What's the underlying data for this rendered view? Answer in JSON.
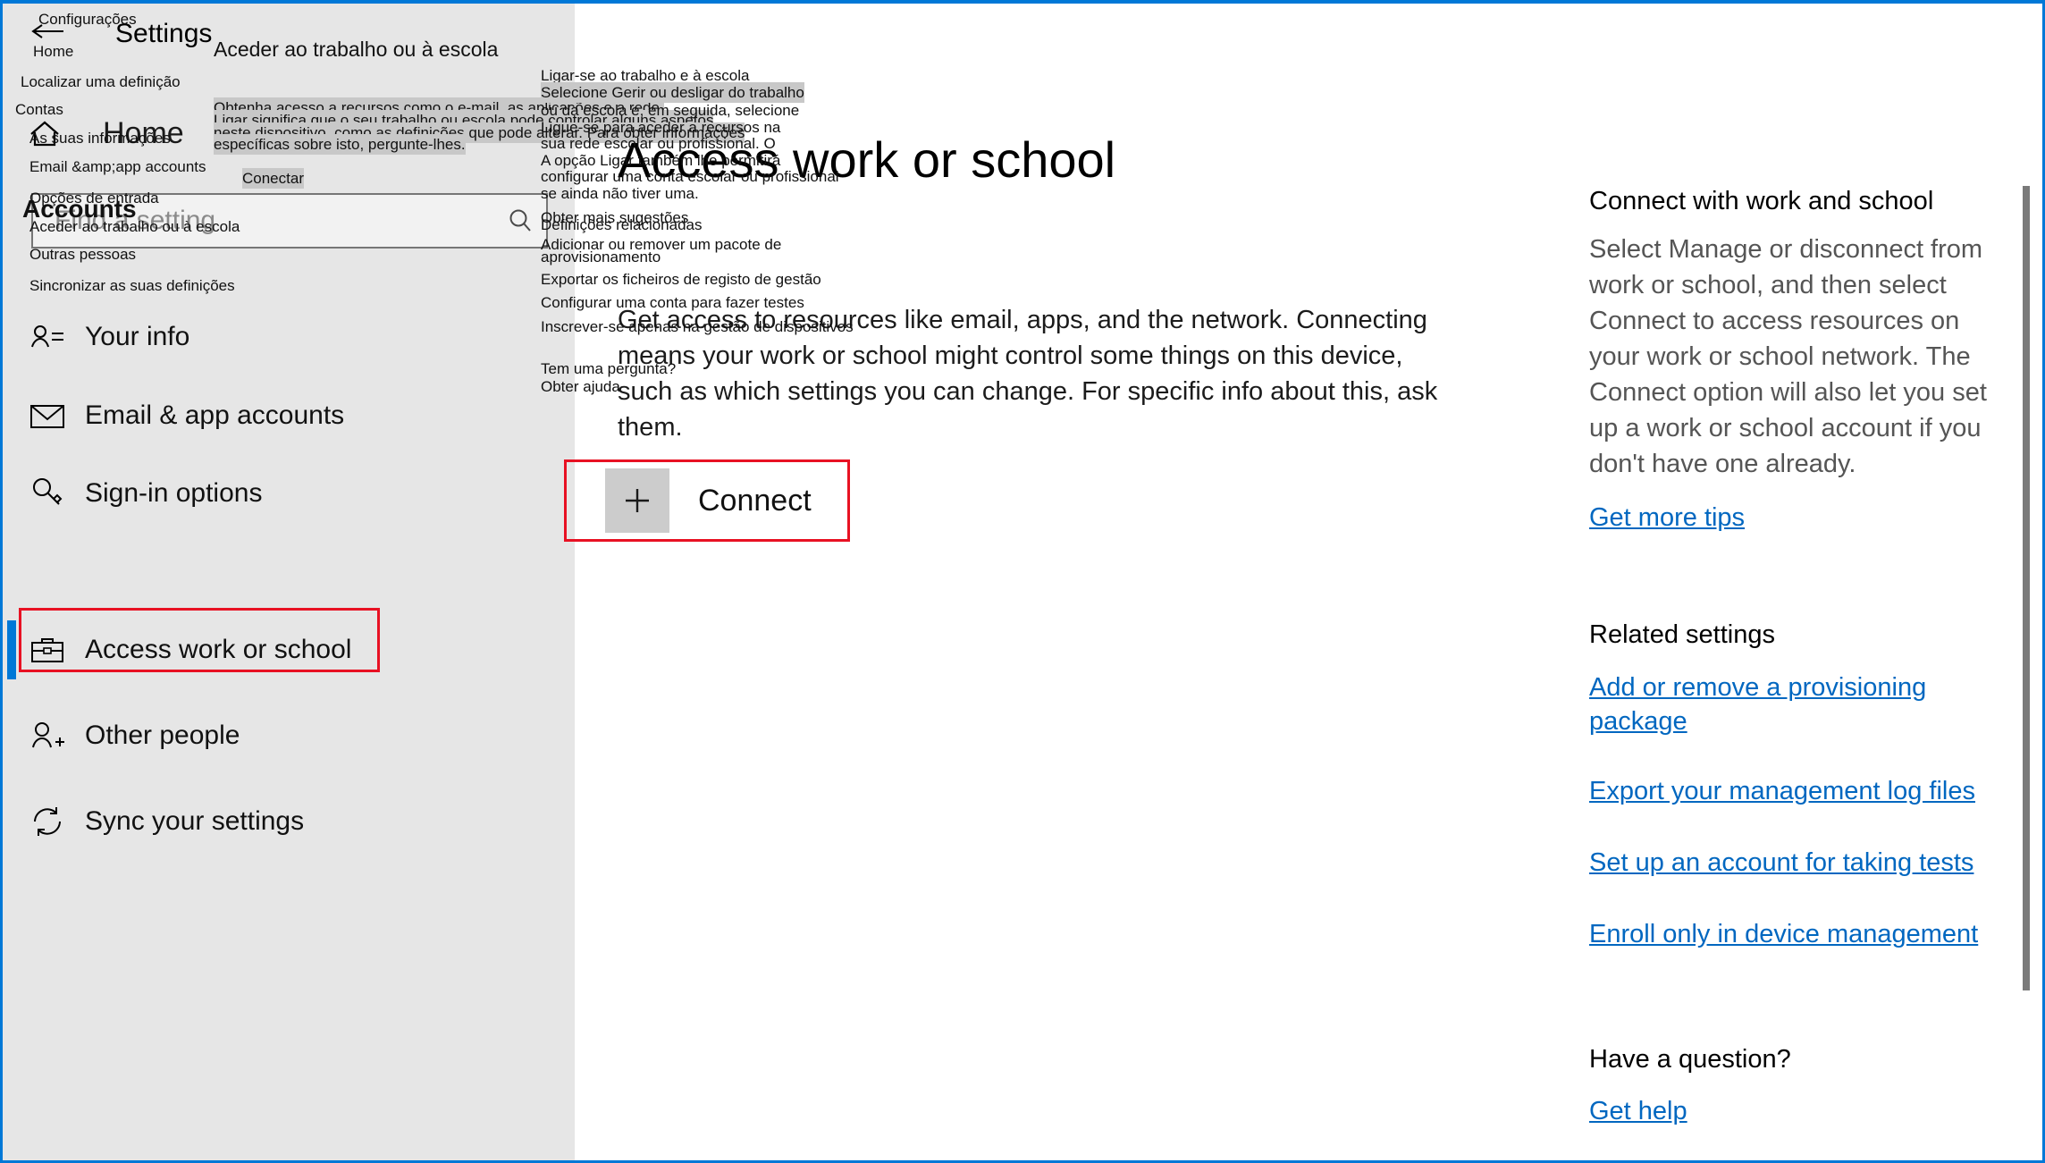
{
  "window": {
    "accent_color": "#0078d7",
    "controls": [
      {
        "name": "minimize",
        "glyph": "minimize-icon"
      },
      {
        "name": "maximize",
        "glyph": "maximize-icon"
      },
      {
        "name": "close",
        "glyph": "close-icon"
      }
    ]
  },
  "sidebar": {
    "app_title": "Settings",
    "back_label": "back-arrow-icon",
    "home": {
      "label": "Home",
      "icon": "home-icon"
    },
    "search": {
      "placeholder": "Find a setting",
      "icon": "search-icon"
    },
    "items": [
      {
        "label": "Your info",
        "icon": "person-card-icon",
        "selected": false
      },
      {
        "label": "Email & app accounts",
        "icon": "envelope-icon",
        "selected": false
      },
      {
        "label": "Sign-in options",
        "icon": "key-icon",
        "selected": false
      },
      {
        "label": "Access work or school",
        "icon": "briefcase-icon",
        "selected": true
      },
      {
        "label": "Other people",
        "icon": "person-plus-icon",
        "selected": false
      },
      {
        "label": "Sync your settings",
        "icon": "sync-icon",
        "selected": false
      }
    ]
  },
  "main": {
    "title": "Access work or school",
    "body": "Get access to resources like email, apps, and the network. Connecting means your work or school might control some things on this device, such as which settings you can change. For specific info about this, ask them.",
    "connect": {
      "label": "Connect",
      "icon": "plus-icon"
    }
  },
  "right_pane": {
    "heading": "Connect with work and school",
    "description": "Select Manage or disconnect from work or school, and then select Connect to access resources on your work or school network. The Connect option will also let you set up a work or school account if you don't have one already.",
    "tips_link": "Get more tips",
    "related_heading": "Related settings",
    "related_links": [
      "Add or remove a provisioning package",
      "Export your management log files",
      "Set up an account for taking tests",
      "Enroll only in device management"
    ],
    "question_heading": "Have a question?",
    "help_link": "Get help"
  },
  "overlay": {
    "t_settings": "Configurações",
    "t_home_bc": "Home",
    "t_find_setting": "Localizar uma definição",
    "t_contas": "Contas",
    "t_your_info": "As suas informações",
    "t_email_accounts": "Email &amp;app accounts",
    "t_signin": "Opções de entrada",
    "t_accounts": "Accounts",
    "t_access_work": "Aceder ao trabalho ou à escola",
    "t_other_people": "Outras pessoas",
    "t_sync": "Sincronizar as suas definições",
    "t_page_title": "Aceder ao trabalho ou à escola",
    "t_body1": "Obtenha acesso a recursos como o e-mail, as aplicações e a rede.",
    "t_body2": "Ligar significa que o seu trabalho ou escola pode controlar alguns aspetos",
    "t_body3": "neste dispositivo, como as definições que pode alterar. Para obter informações",
    "t_body4": "específicas sobre isto, pergunte-lhes.",
    "t_conectar": "Conectar",
    "t_rp_heading": "Ligar-se ao trabalho e à escola",
    "t_rp_d1": "Selecione Gerir ou desligar do trabalho",
    "t_rp_d2": "ou da escola e, em seguida, selecione",
    "t_rp_d3": "Ligue-se para aceder a recursos na",
    "t_rp_d4": "sua rede escolar ou profissional. O",
    "t_rp_d5": "A opção Ligar também lhe permitirá",
    "t_rp_d6": "configurar uma conta escolar ou profissional",
    "t_rp_d7": "se ainda não tiver uma.",
    "t_rp_tips": "Obter mais sugestões",
    "t_rp_related": "Definições relacionadas",
    "t_rp_prov1": "Adicionar ou remover um pacote de",
    "t_rp_prov2": "aprovisionamento",
    "t_rp_export": "Exportar os ficheiros de registo de gestão",
    "t_rp_tests": "Configurar uma conta para fazer testes",
    "t_rp_enroll": "Inscrever-se apenas na gestão de dispositivos",
    "t_rp_question": "Tem uma pergunta?",
    "t_rp_help": "Obter ajuda"
  }
}
